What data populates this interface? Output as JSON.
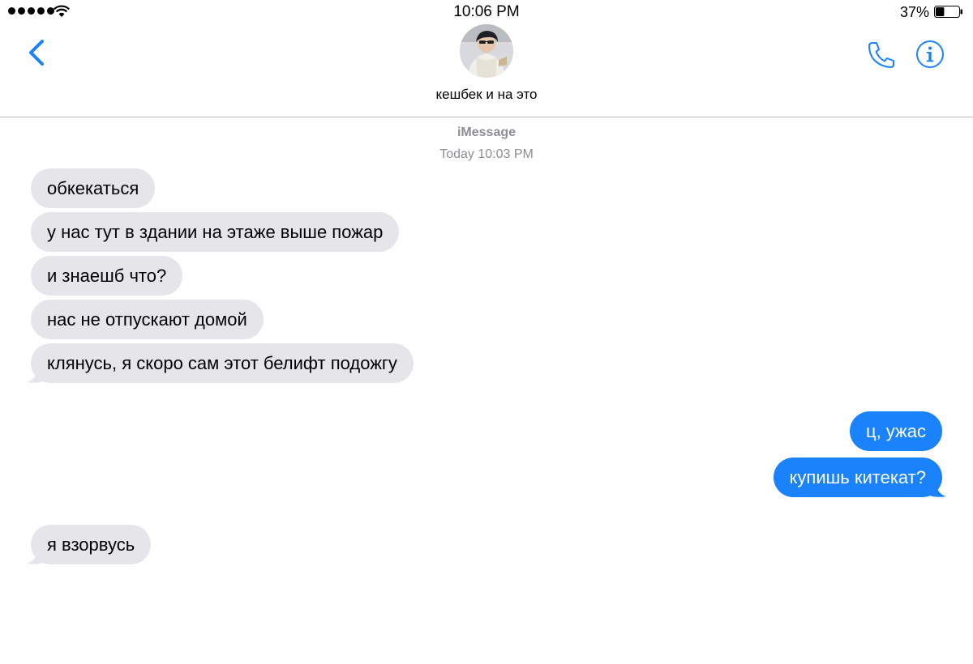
{
  "status_bar": {
    "time": "10:06 PM",
    "battery_percent": "37%",
    "battery_level": 0.37,
    "signal_bars": 5
  },
  "nav": {
    "contact_name": "кешбек и на это",
    "accent_color": "#1a82fb"
  },
  "conversation": {
    "service": "iMessage",
    "timestamp": "Today 10:03 PM",
    "messages": [
      {
        "text": "обкекаться",
        "direction": "incoming"
      },
      {
        "text": "у нас тут в здании на этаже выше пожар",
        "direction": "incoming"
      },
      {
        "text": "и знаешб что?",
        "direction": "incoming"
      },
      {
        "text": "нас не отпускают домой",
        "direction": "incoming"
      },
      {
        "text": "клянусь, я скоро сам этот белифт подожгу",
        "direction": "incoming"
      },
      {
        "text": "ц, ужас",
        "direction": "outgoing"
      },
      {
        "text": "купишь китекат?",
        "direction": "outgoing"
      },
      {
        "text": "я взорвусь",
        "direction": "incoming"
      }
    ],
    "incoming_color": "#e5e5ea",
    "outgoing_color": "#1a82fb"
  }
}
